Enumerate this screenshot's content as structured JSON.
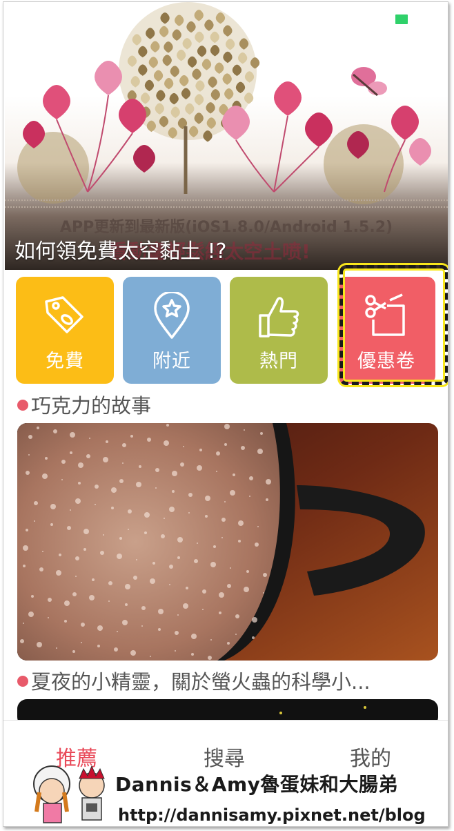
{
  "banner": {
    "subline": "APP更新到最新版(iOS1.8.0/Android 1.5.2)",
    "ghost_text": "看動畫輕鬆經太空土喷!",
    "title": "如何領免費太空黏土 !?"
  },
  "categories": [
    {
      "label": "免費",
      "icon": "price-tag-icon",
      "color": "#fcbd16"
    },
    {
      "label": "附近",
      "icon": "location-pin-star-icon",
      "color": "#7fadd5"
    },
    {
      "label": "熱門",
      "icon": "thumbs-up-icon",
      "color": "#aebb4a"
    },
    {
      "label": "優惠卷",
      "icon": "scissors-coupon-icon",
      "color": "#f15e66"
    }
  ],
  "articles": [
    {
      "title": "巧克力的故事"
    },
    {
      "title": "夏夜的小精靈，關於螢火蟲的科學小..."
    }
  ],
  "bottom_nav": {
    "recommend": "推薦",
    "search": "搜尋",
    "mine": "我的",
    "active_color": "#e94b5a"
  },
  "watermark": {
    "line1": "Dannis＆Amy魯蛋妹和大腸弟",
    "line2": "http://dannisamy.pixnet.net/blog"
  }
}
